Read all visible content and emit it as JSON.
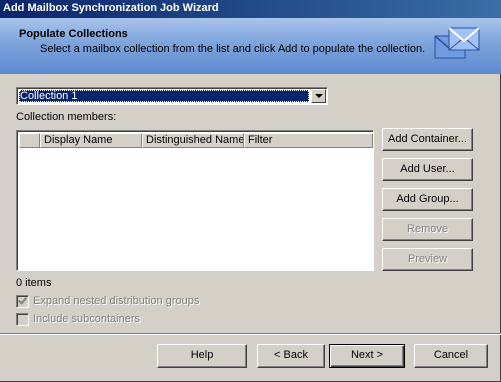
{
  "window": {
    "title": "Add Mailbox Synchronization Job Wizard"
  },
  "header": {
    "title": "Populate Collections",
    "description": "Select a mailbox collection from the list and click Add to populate the collection."
  },
  "collection_select": {
    "selected": "Collection 1"
  },
  "members": {
    "label": "Collection members:",
    "columns": [
      "Display Name",
      "Distinguished Name",
      "Filter"
    ],
    "rows": [],
    "count_text": "0 items"
  },
  "side_buttons": {
    "add_container": "Add Container...",
    "add_user": "Add User...",
    "add_group": "Add Group...",
    "remove": "Remove",
    "preview": "Preview"
  },
  "options": {
    "expand_nested": {
      "label": "Expand nested distribution groups",
      "checked": true,
      "enabled": false
    },
    "include_subcontainers": {
      "label": "Include subcontainers",
      "checked": false,
      "enabled": false
    }
  },
  "footer_buttons": {
    "help": "Help",
    "back": "< Back",
    "next": "Next >",
    "cancel": "Cancel"
  },
  "icons": {
    "header": "envelopes-icon",
    "dropdown": "chevron-down-icon"
  },
  "colors": {
    "title_bar": "#0a246a",
    "header_band": "#7ea4dc",
    "dialog_bg": "#d4d0c8",
    "selection": "#0a246a"
  }
}
